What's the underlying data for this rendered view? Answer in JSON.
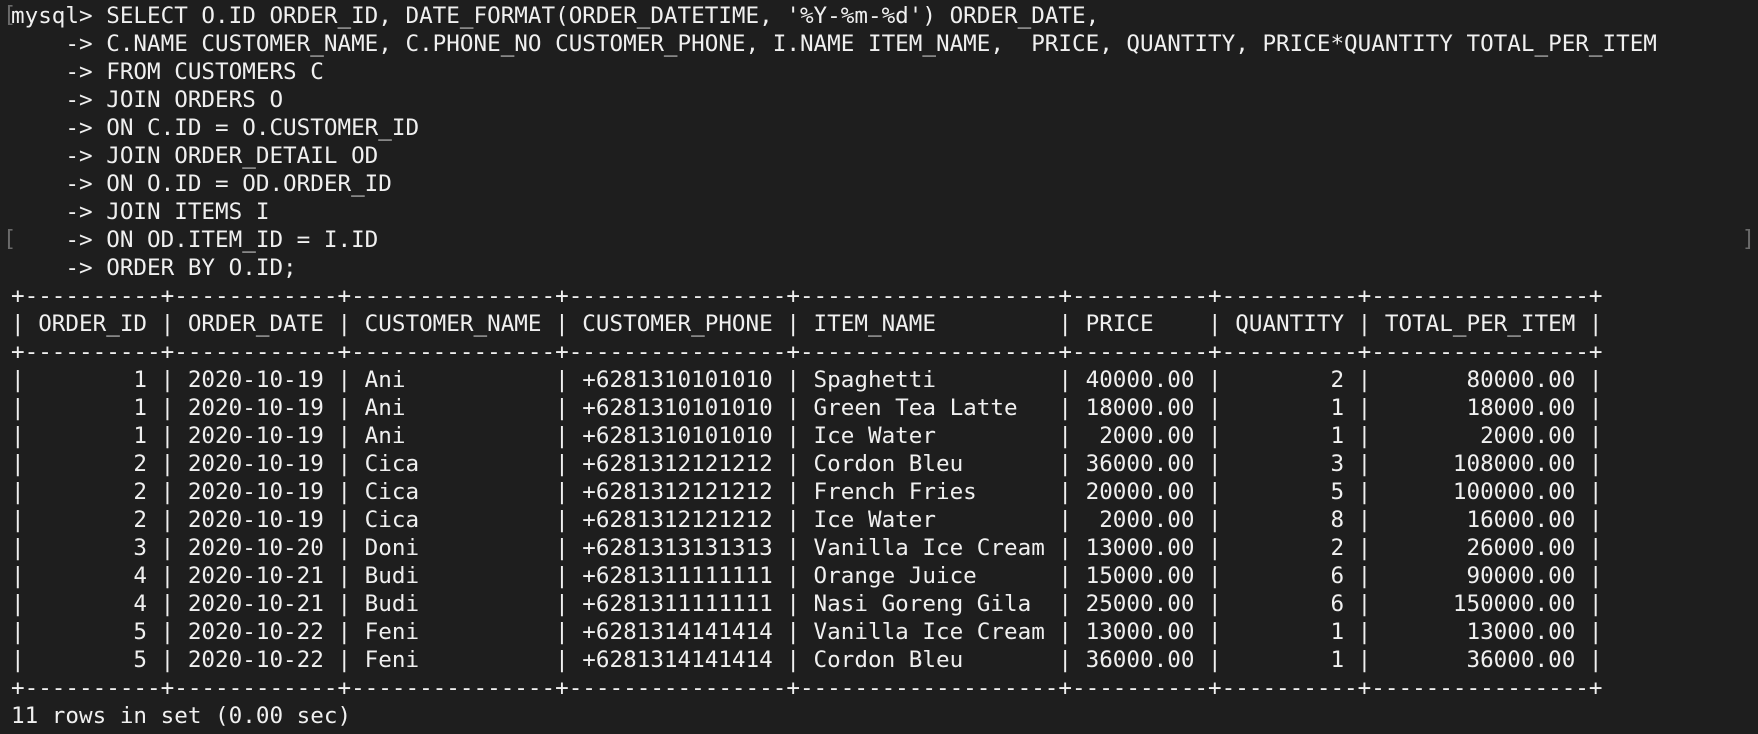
{
  "terminal": {
    "query_lines": [
      "mysql> SELECT O.ID ORDER_ID, DATE_FORMAT(ORDER_DATETIME, '%Y-%m-%d') ORDER_DATE,",
      "    -> C.NAME CUSTOMER_NAME, C.PHONE_NO CUSTOMER_PHONE, I.NAME ITEM_NAME,  PRICE, QUANTITY, PRICE*QUANTITY TOTAL_PER_ITEM",
      "    -> FROM CUSTOMERS C",
      "    -> JOIN ORDERS O",
      "    -> ON C.ID = O.CUSTOMER_ID",
      "    -> JOIN ORDER_DETAIL OD",
      "    -> ON O.ID = OD.ORDER_ID",
      "    -> JOIN ITEMS I",
      "    -> ON OD.ITEM_ID = I.ID",
      "    -> ORDER BY O.ID;"
    ],
    "table": {
      "border": "+----------+------------+---------------+----------------+-------------------+----------+----------+----------------+",
      "header": "| ORDER_ID | ORDER_DATE | CUSTOMER_NAME | CUSTOMER_PHONE | ITEM_NAME         | PRICE    | QUANTITY | TOTAL_PER_ITEM |",
      "rows": [
        "|        1 | 2020-10-19 | Ani           | +6281310101010 | Spaghetti         | 40000.00 |        2 |       80000.00 |",
        "|        1 | 2020-10-19 | Ani           | +6281310101010 | Green Tea Latte   | 18000.00 |        1 |       18000.00 |",
        "|        1 | 2020-10-19 | Ani           | +6281310101010 | Ice Water         |  2000.00 |        1 |        2000.00 |",
        "|        2 | 2020-10-19 | Cica          | +6281312121212 | Cordon Bleu       | 36000.00 |        3 |      108000.00 |",
        "|        2 | 2020-10-19 | Cica          | +6281312121212 | French Fries      | 20000.00 |        5 |      100000.00 |",
        "|        2 | 2020-10-19 | Cica          | +6281312121212 | Ice Water         |  2000.00 |        8 |       16000.00 |",
        "|        3 | 2020-10-20 | Doni          | +6281313131313 | Vanilla Ice Cream | 13000.00 |        2 |       26000.00 |",
        "|        4 | 2020-10-21 | Budi          | +6281311111111 | Orange Juice      | 15000.00 |        6 |       90000.00 |",
        "|        4 | 2020-10-21 | Budi          | +6281311111111 | Nasi Goreng Gila  | 25000.00 |        6 |      150000.00 |",
        "|        5 | 2020-10-22 | Feni          | +6281314141414 | Vanilla Ice Cream | 13000.00 |        1 |       13000.00 |",
        "|        5 | 2020-10-22 | Feni          | +6281314141414 | Cordon Bleu       | 36000.00 |        1 |       36000.00 |"
      ]
    },
    "status": "11 rows in set (0.00 sec)",
    "colors": {
      "background": "#1e1e1e",
      "text": "#f0f0f0"
    }
  }
}
